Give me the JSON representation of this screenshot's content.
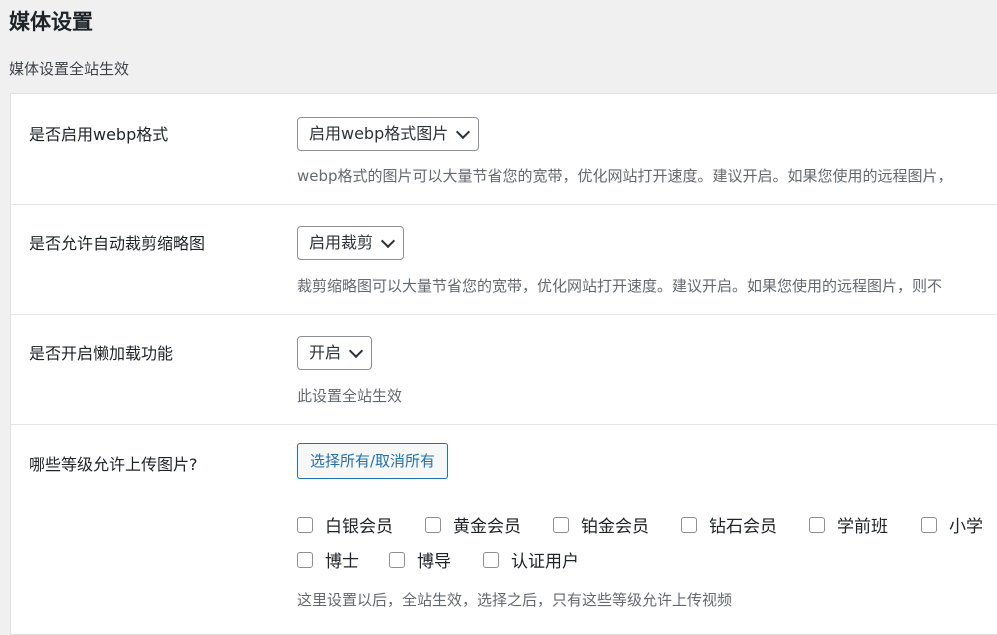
{
  "header": {
    "title": "媒体设置",
    "description": "媒体设置全站生效"
  },
  "settings": {
    "webp": {
      "label": "是否启用webp格式",
      "selected": "启用webp格式图片",
      "help": "webp格式的图片可以大量节省您的宽带，优化网站打开速度。建议开启。如果您使用的远程图片，"
    },
    "crop": {
      "label": "是否允许自动裁剪缩略图",
      "selected": "启用裁剪",
      "help": "裁剪缩略图可以大量节省您的宽带，优化网站打开速度。建议开启。如果您使用的远程图片，则不"
    },
    "lazyload": {
      "label": "是否开启懒加载功能",
      "selected": "开启",
      "help": "此设置全站生效"
    },
    "upload_levels": {
      "label": "哪些等级允许上传图片?",
      "toggle_all_label": "选择所有/取消所有",
      "options": [
        "白银会员",
        "黄金会员",
        "铂金会员",
        "钻石会员",
        "学前班",
        "小学",
        "博士",
        "博导",
        "认证用户"
      ],
      "help": "这里设置以后，全站生效，选择之后，只有这些等级允许上传视频"
    }
  },
  "icons": {
    "dropdown": "chevron-down-icon",
    "checkbox": "checkbox-unchecked-icon"
  },
  "colors": {
    "accent": "#2271b1",
    "background": "#f0f0f1",
    "help_text": "#646970"
  }
}
